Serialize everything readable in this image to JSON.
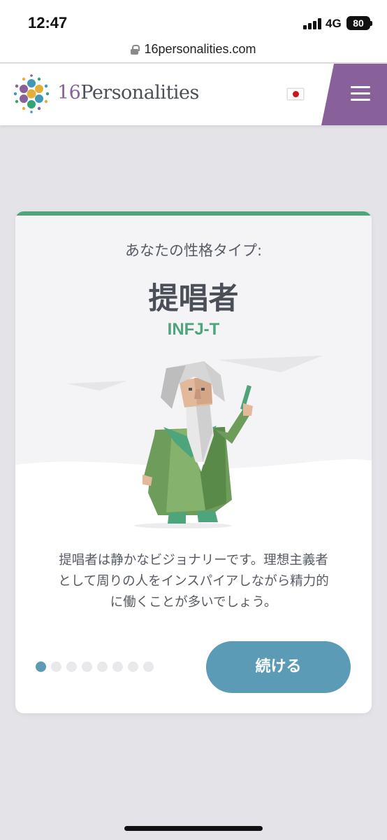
{
  "status_bar": {
    "time": "12:47",
    "network": "4G",
    "battery": "80"
  },
  "browser": {
    "url": "16personalities.com"
  },
  "site_header": {
    "logo_number": "16",
    "logo_word": "Personalities",
    "language_flag": "japan-flag",
    "menu_icon": "hamburger-menu-icon",
    "accent_color": "#88619a"
  },
  "result_card": {
    "intro": "あなたの性格タイプ:",
    "type_name": "提唱者",
    "type_code": "INFJ-T",
    "illustration": "advocate-character-illustration",
    "description_lines": [
      "提唱者は静かなビジョナリーです。理想主義者",
      "として周りの人をインスパイアしながら精力的",
      "に働くことが多いでしょう。"
    ],
    "pager": {
      "total": 8,
      "current": 1
    },
    "continue_label": "続ける",
    "accent_color": "#4ea47b",
    "button_color": "#5b9bb5"
  }
}
